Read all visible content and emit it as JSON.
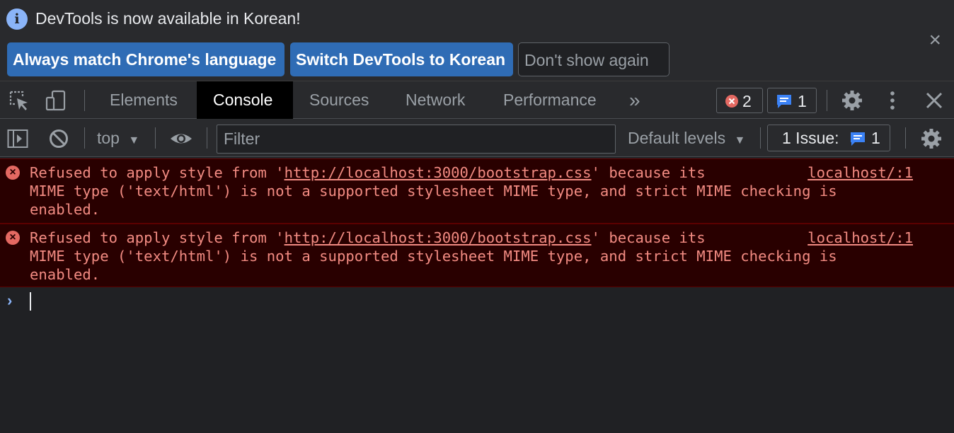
{
  "infobar": {
    "message": "DevTools is now available in Korean!",
    "btn_match": "Always match Chrome's language",
    "btn_switch": "Switch DevTools to Korean",
    "btn_dont_show": "Don't show again",
    "close_glyph": "×"
  },
  "tabs": {
    "items": [
      "Elements",
      "Console",
      "Sources",
      "Network",
      "Performance"
    ],
    "active": "Console",
    "more_glyph": "»",
    "error_count": "2",
    "message_count": "1",
    "close_glyph": "✕"
  },
  "console_toolbar": {
    "context": "top",
    "filter_placeholder": "Filter",
    "levels": "Default levels",
    "issues_label": "1 Issue:",
    "issues_count": "1"
  },
  "messages": [
    {
      "prefix": "Refused to apply style from '",
      "url": "http://localhost:3000/bootstrap.css",
      "suffix": "' because its",
      "line2": "MIME type ('text/html') is not a supported stylesheet MIME type, and strict MIME checking is",
      "line3": "enabled.",
      "source": "localhost/:1"
    },
    {
      "prefix": "Refused to apply style from '",
      "url": "http://localhost:3000/bootstrap.css",
      "suffix": "' because its",
      "line2": "MIME type ('text/html') is not a supported stylesheet MIME type, and strict MIME checking is",
      "line3": "enabled.",
      "source": "localhost/:1"
    }
  ],
  "colors": {
    "error_text": "#f28b82",
    "error_bg": "#290000",
    "accent": "#8ab4f8",
    "button_blue": "#2f6cb5"
  },
  "icons": {
    "info": "info-icon",
    "inspect": "inspect-element-icon",
    "device": "device-toolbar-icon",
    "settings": "gear-icon",
    "kebab": "more-vertical-icon",
    "sidebar": "sidebar-toggle-icon",
    "clear": "clear-console-icon",
    "eye": "live-expression-icon",
    "error": "error-icon",
    "message": "message-icon"
  }
}
